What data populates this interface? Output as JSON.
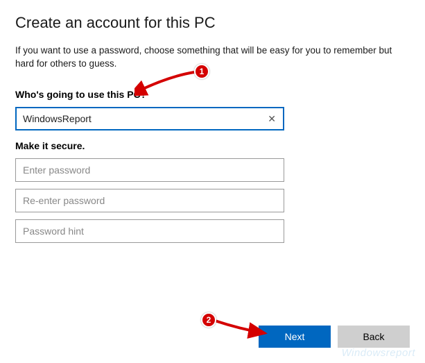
{
  "heading": "Create an account for this PC",
  "instruction": "If you want to use a password, choose something that will be easy for you to remember but hard for others to guess.",
  "section_user": {
    "label": "Who's going to use this PC?",
    "username_value": "WindowsReport"
  },
  "section_secure": {
    "label": "Make it secure.",
    "password_placeholder": "Enter password",
    "reenter_placeholder": "Re-enter password",
    "hint_placeholder": "Password hint"
  },
  "footer": {
    "next_label": "Next",
    "back_label": "Back"
  },
  "annotations": {
    "badge1": "1",
    "badge2": "2"
  },
  "watermark": "Windowsreport"
}
